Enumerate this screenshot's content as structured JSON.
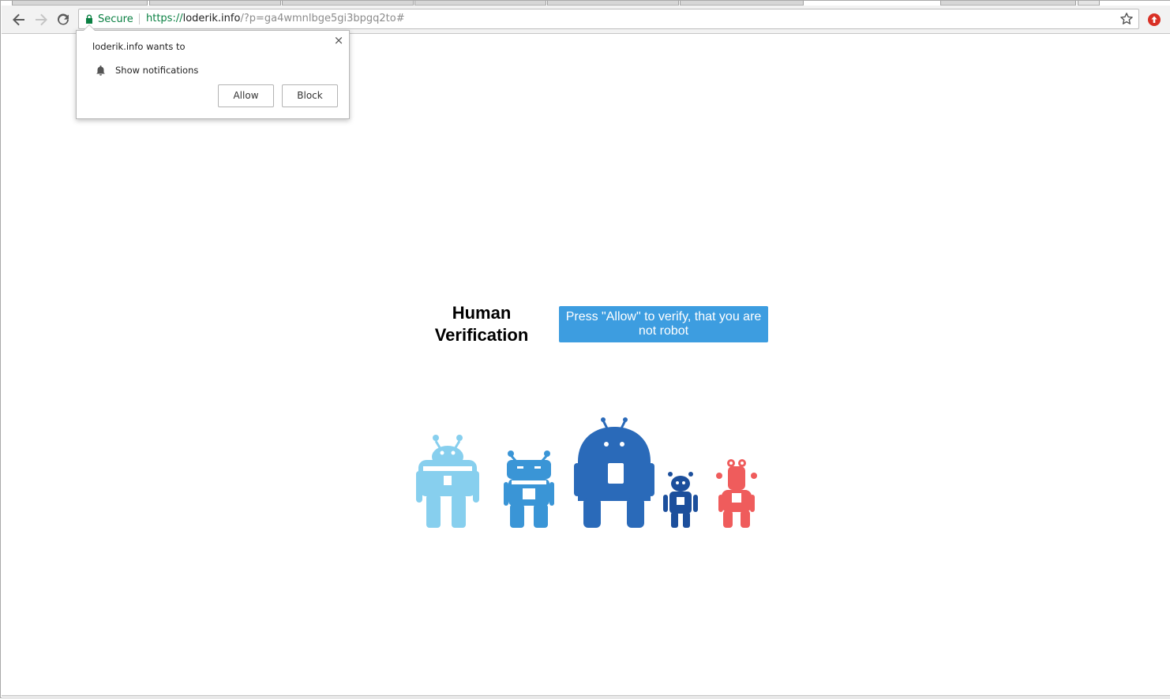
{
  "browser": {
    "secure_label": "Secure",
    "url_scheme": "https://",
    "url_host": "loderik.info",
    "url_rest": "/?p=ga4wmnlbge5gi3bpgq2to#",
    "icons": {
      "back": "arrow-left-icon",
      "forward": "arrow-right-icon",
      "reload": "reload-icon",
      "lock": "lock-icon",
      "bookmark": "star-icon",
      "extension": "red-circle-arrow-icon"
    },
    "colors": {
      "secure_green": "#0b8043",
      "toolbar_bg": "#f2f2f2"
    }
  },
  "permission_prompt": {
    "title": "loderik.info wants to",
    "permission_label": "Show notifications",
    "permission_icon": "bell-icon",
    "close_symbol": "×",
    "allow_label": "Allow",
    "block_label": "Block"
  },
  "page": {
    "heading_line1": "Human",
    "heading_line2": "Verification",
    "verify_button_label": "Press \"Allow\" to verify, that you are not robot",
    "colors": {
      "button_bg": "#3d9de0",
      "robot_light_blue": "#87cfee",
      "robot_blue": "#3a95d6",
      "robot_dark_blue": "#2a6ab9",
      "robot_navy": "#1c4f9c",
      "robot_red": "#ef5c5c"
    },
    "robot_illustration": "five-robots-illustration"
  }
}
